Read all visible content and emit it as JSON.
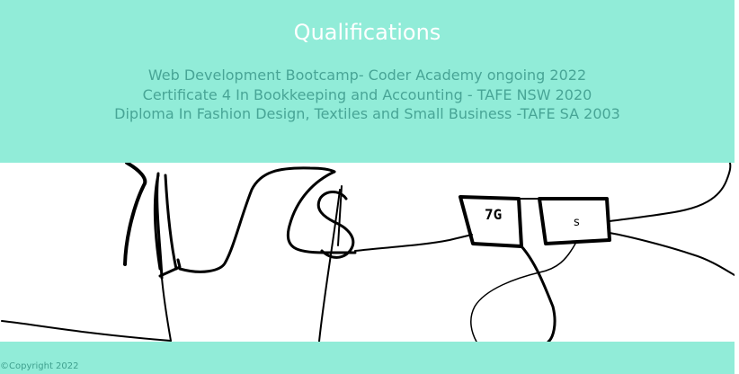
{
  "header": {
    "title": "Qualifications",
    "qualifications": [
      "Web Development Bootcamp- Coder Academy ongoing 2022",
      "Certificate 4 In Bookkeeping and Accounting - TAFE NSW 2020",
      "Diploma In Fashion Design, Textiles and Small Business -TAFE SA 2003"
    ]
  },
  "sketch": {
    "box1_text": "7G",
    "box2_text": "s"
  },
  "footer": {
    "copyright": "©Copyright 2022"
  },
  "colors": {
    "band": "#91ecd8",
    "title": "#ffffff",
    "qualification_text": "#48a596",
    "ink": "#000000"
  }
}
